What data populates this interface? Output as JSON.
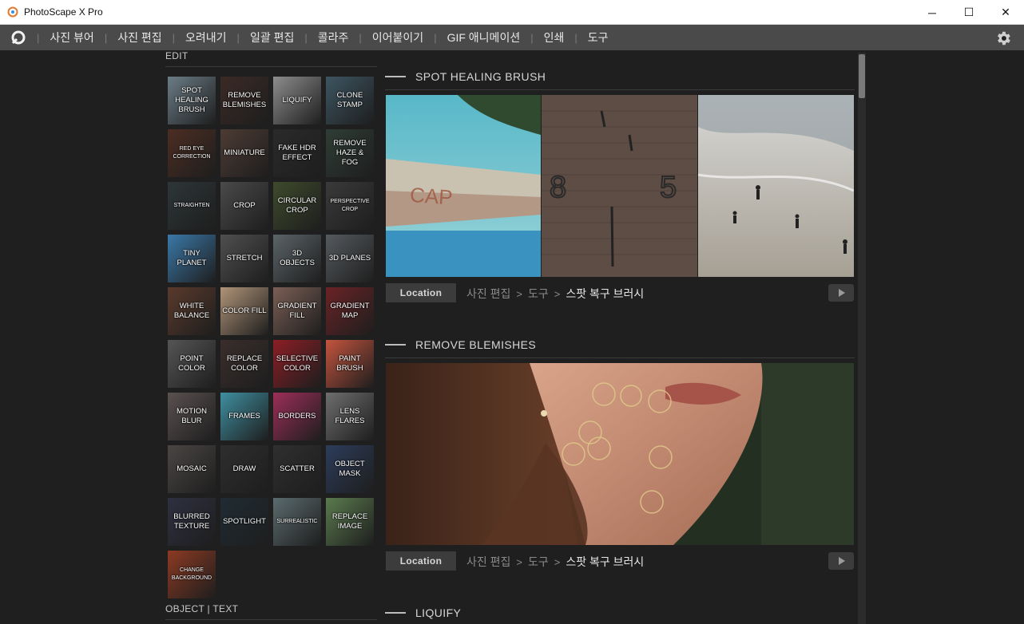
{
  "window": {
    "title": "PhotoScape X Pro",
    "minimize": "─",
    "maximize": "☐",
    "close": "✕"
  },
  "menu": {
    "items": [
      "사진 뷰어",
      "사진 편집",
      "오려내기",
      "일괄 편집",
      "콜라주",
      "이어붙이기",
      "GIF 애니메이션",
      "인쇄",
      "도구"
    ]
  },
  "left": {
    "section_edit": "EDIT",
    "section_object": "OBJECT | TEXT",
    "tiles": [
      {
        "label": "SPOT HEALING BRUSH",
        "color": "#6b7c86"
      },
      {
        "label": "REMOVE BLEMISHES",
        "color": "#3b2a26"
      },
      {
        "label": "LIQUIFY",
        "color": "#8d8d8d"
      },
      {
        "label": "CLONE STAMP",
        "color": "#3d5561"
      },
      {
        "label": "RED EYE CORRECTION",
        "color": "#4c2d22",
        "small": true
      },
      {
        "label": "MINIATURE",
        "color": "#4d3b34"
      },
      {
        "label": "FAKE HDR EFFECT",
        "color": "#2a2a2a"
      },
      {
        "label": "REMOVE HAZE & FOG",
        "color": "#2f3d36"
      },
      {
        "label": "STRAIGHTEN",
        "color": "#2d3638",
        "small": true
      },
      {
        "label": "CROP",
        "color": "#4b4a4b"
      },
      {
        "label": "CIRCULAR CROP",
        "color": "#3e4a2c"
      },
      {
        "label": "PERSPECTIVE CROP",
        "color": "#3a3a3a",
        "small": true
      },
      {
        "label": "TINY PLANET",
        "color": "#3a78a8"
      },
      {
        "label": "STRETCH",
        "color": "#4f4f4f"
      },
      {
        "label": "3D OBJECTS",
        "color": "#5b6468"
      },
      {
        "label": "3D PLANES",
        "color": "#555a5e"
      },
      {
        "label": "WHITE BALANCE",
        "color": "#5a3a2c"
      },
      {
        "label": "COLOR FILL",
        "color": "#b09478"
      },
      {
        "label": "GRADIENT FILL",
        "color": "#7b5f55"
      },
      {
        "label": "GRADIENT MAP",
        "color": "#6a2326"
      },
      {
        "label": "POINT COLOR",
        "color": "#555555"
      },
      {
        "label": "REPLACE COLOR",
        "color": "#3a2e2c"
      },
      {
        "label": "SELECTIVE COLOR",
        "color": "#8c1e25"
      },
      {
        "label": "PAINT BRUSH",
        "color": "#c4543e"
      },
      {
        "label": "MOTION BLUR",
        "color": "#5a5050"
      },
      {
        "label": "FRAMES",
        "color": "#3f8fa0"
      },
      {
        "label": "BORDERS",
        "color": "#9c2e58"
      },
      {
        "label": "LENS FLARES",
        "color": "#6e6e6e"
      },
      {
        "label": "MOSAIC",
        "color": "#4a4644"
      },
      {
        "label": "DRAW",
        "color": "#2e2e2e"
      },
      {
        "label": "SCATTER",
        "color": "#2f2f2f"
      },
      {
        "label": "OBJECT MASK",
        "color": "#2c3c5a"
      },
      {
        "label": "BLURRED TEXTURE",
        "color": "#2e3040"
      },
      {
        "label": "SPOTLIGHT",
        "color": "#1f2c33"
      },
      {
        "label": "SURREALISTIC",
        "color": "#5b6b6e",
        "small": true
      },
      {
        "label": "REPLACE IMAGE",
        "color": "#5a7b4e"
      },
      {
        "label": "CHANGE BACKGROUND",
        "color": "#8c3a22",
        "small": true
      }
    ]
  },
  "features": [
    {
      "title": "SPOT HEALING BRUSH",
      "location_label": "Location",
      "crumb1": "사진 편집",
      "crumb2": "도구",
      "crumb3": "스팟 복구 브러시"
    },
    {
      "title": "REMOVE BLEMISHES",
      "location_label": "Location",
      "crumb1": "사진 편집",
      "crumb2": "도구",
      "crumb3": "스팟 복구 브러시"
    },
    {
      "title": "LIQUIFY"
    }
  ],
  "icons": {
    "settings": "gear-icon",
    "play": "play-icon",
    "logo": "photoscape-logo-icon"
  },
  "image_text": {
    "numbers": [
      "8",
      "5"
    ]
  },
  "colors": {
    "background": "#1f1f1f",
    "menubar": "#4a4a4a",
    "accent": "#bdbdbd"
  }
}
